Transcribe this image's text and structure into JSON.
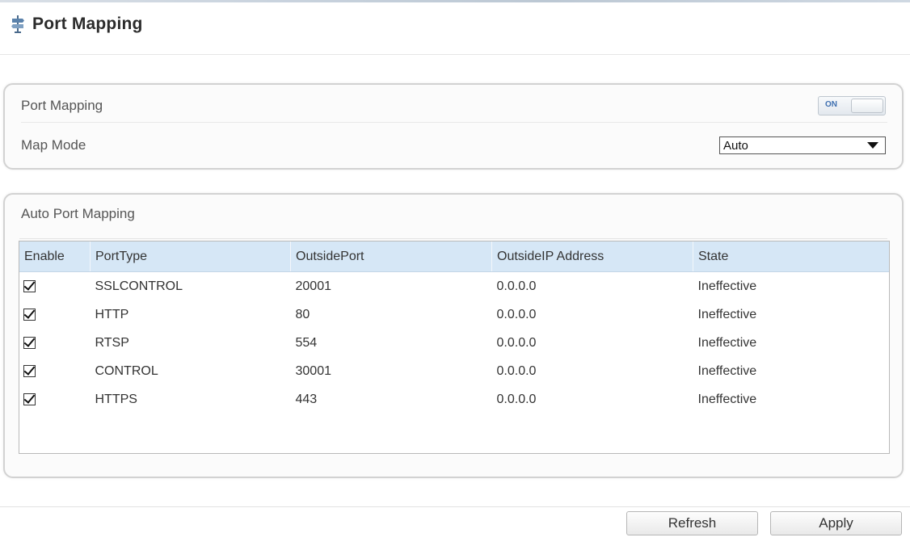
{
  "header": {
    "title": "Port Mapping",
    "icon": "port-mapping-icon"
  },
  "settings": {
    "port_mapping_label": "Port Mapping",
    "toggle_state": "ON",
    "map_mode_label": "Map Mode",
    "map_mode_value": "Auto"
  },
  "auto_port_mapping": {
    "title": "Auto Port Mapping",
    "columns": [
      "Enable",
      "PortType",
      "OutsidePort",
      "OutsideIP Address",
      "State"
    ],
    "rows": [
      {
        "enabled": true,
        "port_type": "SSLCONTROL",
        "outside_port": "20001",
        "outside_ip": "0.0.0.0",
        "state": "Ineffective"
      },
      {
        "enabled": true,
        "port_type": "HTTP",
        "outside_port": "80",
        "outside_ip": "0.0.0.0",
        "state": "Ineffective"
      },
      {
        "enabled": true,
        "port_type": "RTSP",
        "outside_port": "554",
        "outside_ip": "0.0.0.0",
        "state": "Ineffective"
      },
      {
        "enabled": true,
        "port_type": "CONTROL",
        "outside_port": "30001",
        "outside_ip": "0.0.0.0",
        "state": "Ineffective"
      },
      {
        "enabled": true,
        "port_type": "HTTPS",
        "outside_port": "443",
        "outside_ip": "0.0.0.0",
        "state": "Ineffective"
      }
    ]
  },
  "footer": {
    "refresh_label": "Refresh",
    "apply_label": "Apply"
  },
  "colors": {
    "table_header_bg": "#d6e7f6",
    "toggle_on_text": "#3e6fb0"
  }
}
